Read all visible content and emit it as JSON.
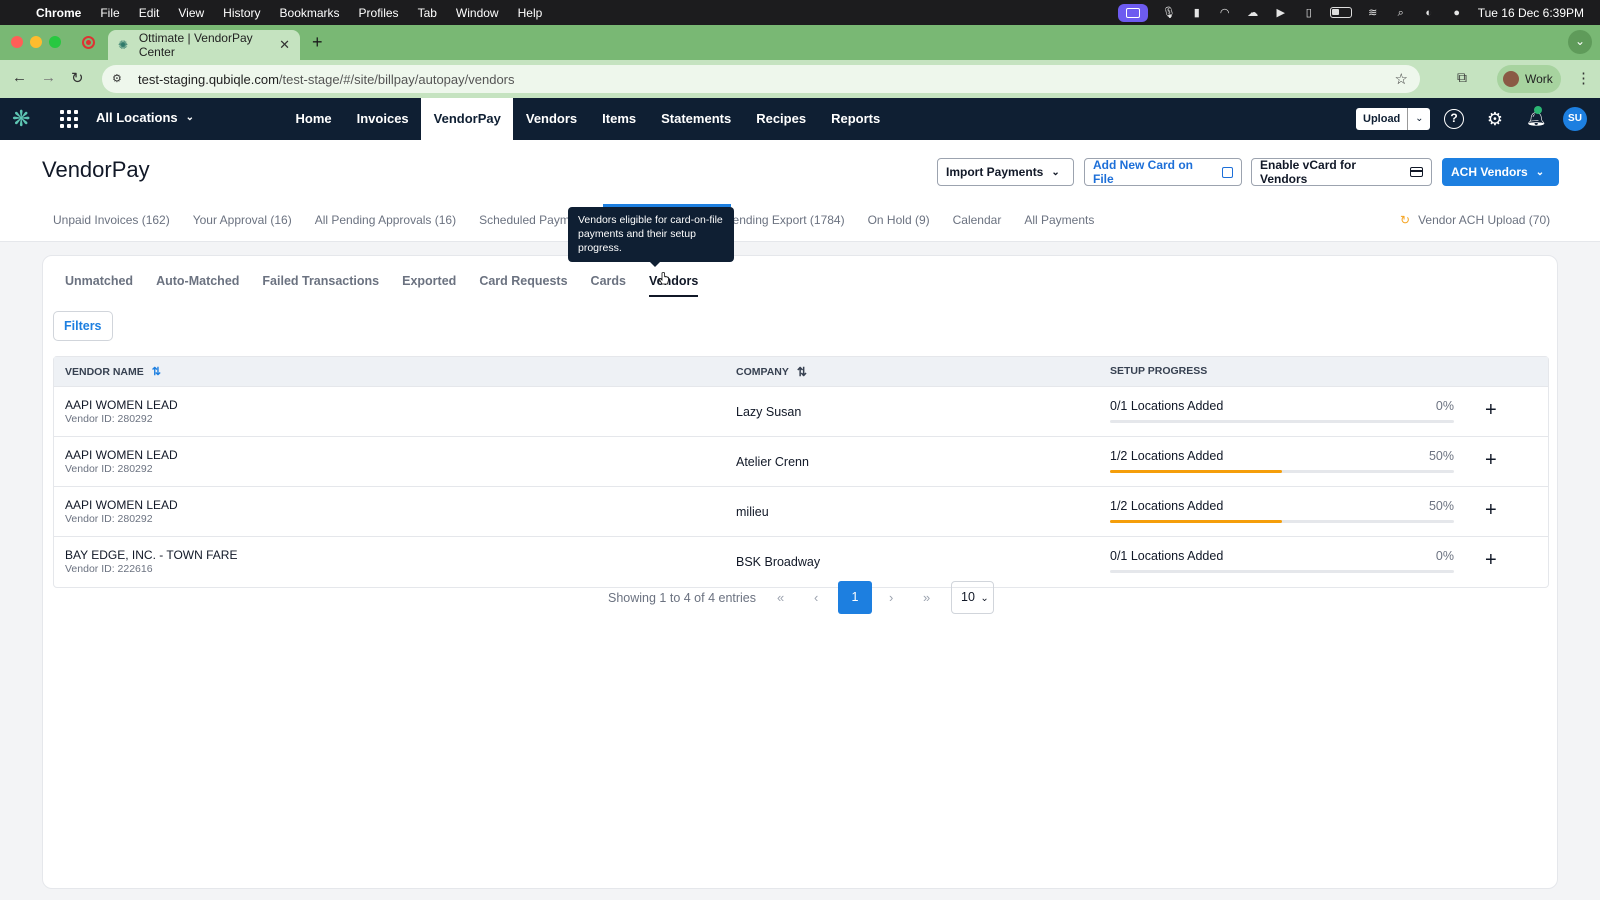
{
  "mac_menubar": {
    "app": "Chrome",
    "menus": [
      "File",
      "Edit",
      "View",
      "History",
      "Bookmarks",
      "Profiles",
      "Tab",
      "Window",
      "Help"
    ],
    "datetime": "Tue 16 Dec  6:39PM"
  },
  "browser": {
    "tab_title": "Ottimate | VendorPay Center",
    "url_host": "test-staging.qubiqle.com",
    "url_path": "/test-stage/#/site/billpay/autopay/vendors",
    "profile_label": "Work"
  },
  "app_header": {
    "location_selector": "All Locations",
    "nav": [
      "Home",
      "Invoices",
      "VendorPay",
      "Vendors",
      "Items",
      "Statements",
      "Recipes",
      "Reports"
    ],
    "active_nav": "VendorPay",
    "upload_label": "Upload",
    "avatar_initials": "SU"
  },
  "page": {
    "title": "VendorPay",
    "buttons": {
      "import": "Import Payments",
      "add_card": "Add New Card on File",
      "vcard": "Enable vCard for Vendors",
      "ach": "ACH Vendors"
    },
    "subtabs": [
      "Unpaid Invoices (162)",
      "Your Approval (16)",
      "All Pending Approvals (16)",
      "Scheduled Payment",
      "Pending Export (1784)",
      "On Hold (9)",
      "Calendar",
      "All Payments"
    ],
    "vendor_ach_upload": "Vendor ACH Upload (70)"
  },
  "inner_tabs": [
    "Unmatched",
    "Auto-Matched",
    "Failed Transactions",
    "Exported",
    "Card Requests",
    "Cards",
    "Vendors"
  ],
  "active_inner_tab": "Vendors",
  "tooltip": "Vendors eligible for card-on-file payments and their setup progress.",
  "filters_label": "Filters",
  "table": {
    "headers": {
      "vendor_name": "VENDOR NAME",
      "company": "COMPANY",
      "setup_progress": "SETUP PROGRESS"
    },
    "rows": [
      {
        "vendor_name": "AAPI WOMEN LEAD",
        "vendor_id": "Vendor ID: 280292",
        "company": "Lazy Susan",
        "progress_label": "0/1 Locations Added",
        "progress_pct": "0%",
        "progress_fraction": 0.0
      },
      {
        "vendor_name": "AAPI WOMEN LEAD",
        "vendor_id": "Vendor ID: 280292",
        "company": "Atelier Crenn",
        "progress_label": "1/2 Locations Added",
        "progress_pct": "50%",
        "progress_fraction": 0.5
      },
      {
        "vendor_name": "AAPI WOMEN LEAD",
        "vendor_id": "Vendor ID: 280292",
        "company": "milieu",
        "progress_label": "1/2 Locations Added",
        "progress_pct": "50%",
        "progress_fraction": 0.5
      },
      {
        "vendor_name": "BAY EDGE, INC. - TOWN FARE",
        "vendor_id": "Vendor ID: 222616",
        "company": "BSK Broadway",
        "progress_label": "0/1 Locations Added",
        "progress_pct": "0%",
        "progress_fraction": 0.0
      }
    ]
  },
  "pagination": {
    "summary": "Showing 1 to 4 of 4 entries",
    "current_page": "1",
    "page_size": "10"
  },
  "colors": {
    "header_bg": "#0f1f33",
    "accent": "#1d7fe0",
    "progress": "#f59e0b",
    "browser_green": "#79b874"
  }
}
